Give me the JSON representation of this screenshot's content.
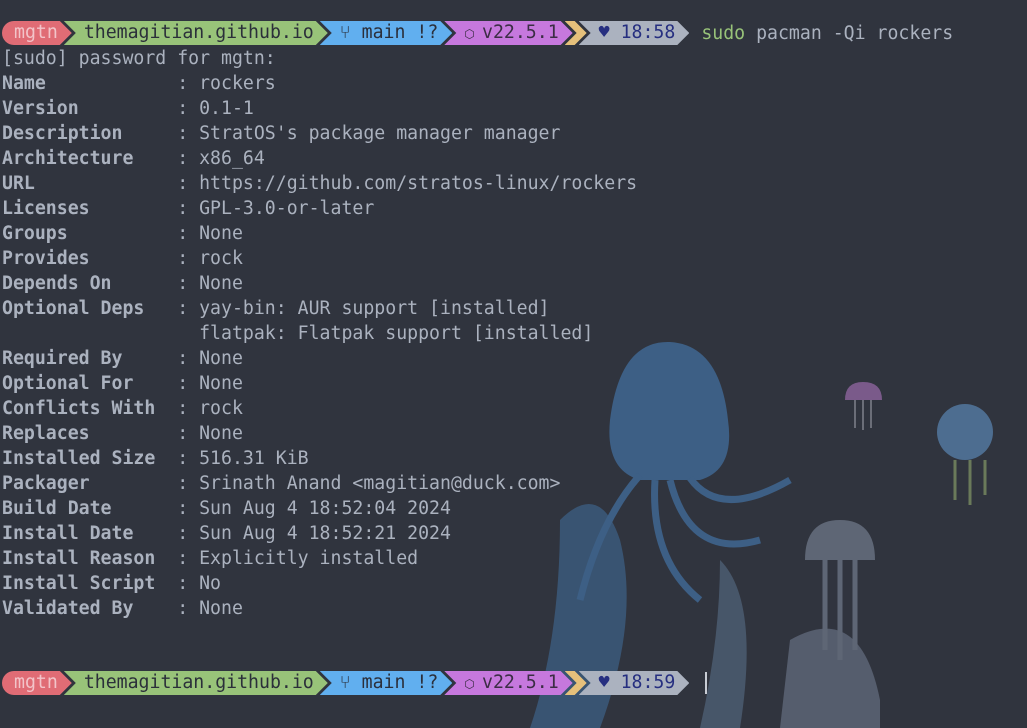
{
  "prompt1": {
    "user": "mgtn",
    "dir": "themagitian.github.io",
    "branch": "main !?",
    "node": "v22.5.1",
    "time": "18:58",
    "cmd_sudo": "sudo",
    "cmd_rest": "pacman -Qi rockers"
  },
  "prompt2": {
    "user": "mgtn",
    "dir": "themagitian.github.io",
    "branch": "main !?",
    "node": "v22.5.1",
    "time": "18:59"
  },
  "icons": {
    "branch": "git-branch-icon",
    "node": "nodejs-icon",
    "heart": "♥"
  },
  "colors": {
    "user": "#e06c75",
    "dir": "#98c379",
    "branch": "#61afef",
    "node": "#c678dd",
    "sep": "#e5c07b",
    "time": "#abb2bf",
    "bg": "#30343e"
  },
  "sudo_prompt": "[sudo] password for mgtn:",
  "fields": [
    {
      "label": "Name            ",
      "value": "rockers"
    },
    {
      "label": "Version         ",
      "value": "0.1-1"
    },
    {
      "label": "Description     ",
      "value": "StratOS's package manager manager"
    },
    {
      "label": "Architecture    ",
      "value": "x86_64"
    },
    {
      "label": "URL             ",
      "value": "https://github.com/stratos-linux/rockers"
    },
    {
      "label": "Licenses        ",
      "value": "GPL-3.0-or-later"
    },
    {
      "label": "Groups          ",
      "value": "None"
    },
    {
      "label": "Provides        ",
      "value": "rock"
    },
    {
      "label": "Depends On      ",
      "value": "None"
    },
    {
      "label": "Optional Deps   ",
      "value": "yay-bin: AUR support [installed]"
    },
    {
      "label": "                ",
      "value": "flatpak: Flatpak support [installed]"
    },
    {
      "label": "Required By     ",
      "value": "None"
    },
    {
      "label": "Optional For    ",
      "value": "None"
    },
    {
      "label": "Conflicts With  ",
      "value": "rock"
    },
    {
      "label": "Replaces        ",
      "value": "None"
    },
    {
      "label": "Installed Size  ",
      "value": "516.31 KiB"
    },
    {
      "label": "Packager        ",
      "value": "Srinath Anand <magitian@duck.com>"
    },
    {
      "label": "Build Date      ",
      "value": "Sun Aug 4 18:52:04 2024"
    },
    {
      "label": "Install Date    ",
      "value": "Sun Aug 4 18:52:21 2024"
    },
    {
      "label": "Install Reason  ",
      "value": "Explicitly installed"
    },
    {
      "label": "Install Script  ",
      "value": "No"
    },
    {
      "label": "Validated By    ",
      "value": "None"
    }
  ]
}
